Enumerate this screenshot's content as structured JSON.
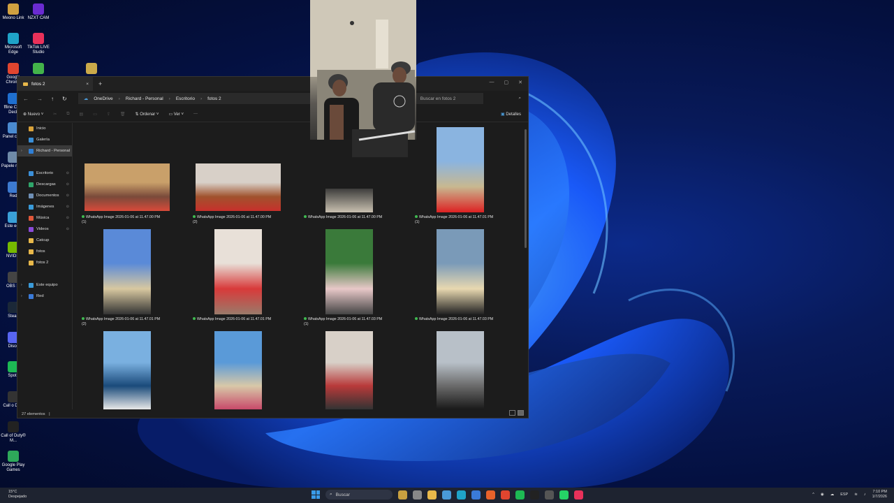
{
  "desktop": {
    "icons": [
      {
        "label": "Meono Link",
        "color": "#d0a040"
      },
      {
        "label": "NZXT CAM",
        "color": "#6a2bd0"
      },
      {
        "label": "Microsoft Edge",
        "color": "#1fa3c8"
      },
      {
        "label": "TikTok LIVE Studio",
        "color": "#e8315a"
      },
      {
        "label": "Google Chrome",
        "color": "#e0452f"
      },
      {
        "label": "",
        "color": "#43b34a"
      },
      {
        "label": "",
        "color": "#caa94a"
      },
      {
        "label": "ffline Co... Deck",
        "color": "#1f6fd0"
      },
      {
        "label": "Panel contr",
        "color": "#4a8ad0"
      },
      {
        "label": "Papele recicl",
        "color": "#6f8aa8"
      },
      {
        "label": "Red",
        "color": "#3d7ad0"
      },
      {
        "label": "Este equi",
        "color": "#3aa0d8"
      },
      {
        "label": "NVIDIA",
        "color": "#76b900"
      },
      {
        "label": "OBS St",
        "color": "#444"
      },
      {
        "label": "Stean",
        "color": "#1b2838"
      },
      {
        "label": "Disco",
        "color": "#5865f2"
      },
      {
        "label": "Spotif",
        "color": "#1db954"
      },
      {
        "label": "Call o Duty",
        "color": "#333"
      },
      {
        "label": "Call of Duty® M...",
        "color": "#222"
      },
      {
        "label": "Google Play Games",
        "color": "#2ea85a"
      }
    ]
  },
  "explorer": {
    "tab_title": "fotos 2",
    "tab_close": "×",
    "new_tab": "+",
    "window_controls": [
      "—",
      "▢",
      "✕"
    ],
    "breadcrumb": [
      "OneDrive",
      "Richard - Personal",
      "Escritorio",
      "fotos 2"
    ],
    "breadcrumb_sep": "›",
    "search_placeholder": "Buscar en fotos 2",
    "toolbar": {
      "new_label": "Nuevo",
      "sort_label": "Ordenar",
      "view_label": "Ver",
      "more": "···",
      "details_label": "Detalles"
    },
    "sidebar": [
      {
        "label": "Inicio",
        "color": "#d9a23a",
        "pinned": false,
        "chevron": false
      },
      {
        "label": "Galería",
        "color": "#3a8ed6",
        "pinned": false,
        "chevron": false
      },
      {
        "label": "Richard - Personal",
        "color": "#2f7fd6",
        "pinned": false,
        "chevron": true,
        "selected": true
      },
      {
        "label": "",
        "color": "transparent",
        "pinned": false,
        "chevron": false
      },
      {
        "label": "Escritorio",
        "color": "#3b8fd8",
        "pinned": true,
        "chevron": false
      },
      {
        "label": "Descargas",
        "color": "#2fa56a",
        "pinned": true,
        "chevron": false
      },
      {
        "label": "Documentos",
        "color": "#6f8fb5",
        "pinned": true,
        "chevron": false
      },
      {
        "label": "Imágenes",
        "color": "#3a9ad8",
        "pinned": true,
        "chevron": false
      },
      {
        "label": "Música",
        "color": "#e0573a",
        "pinned": true,
        "chevron": false
      },
      {
        "label": "Videos",
        "color": "#8a4ad8",
        "pinned": true,
        "chevron": false
      },
      {
        "label": "Catcup",
        "color": "#e8b84a",
        "pinned": false,
        "chevron": false
      },
      {
        "label": "fotos",
        "color": "#e8b84a",
        "pinned": false,
        "chevron": false
      },
      {
        "label": "fotos 2",
        "color": "#e8b84a",
        "pinned": false,
        "chevron": false
      },
      {
        "label": "",
        "color": "transparent",
        "pinned": false,
        "chevron": false
      },
      {
        "label": "Este equipo",
        "color": "#3a9ad8",
        "pinned": false,
        "chevron": true
      },
      {
        "label": "Red",
        "color": "#3a7ad8",
        "pinned": false,
        "chevron": true
      }
    ],
    "files": [
      {
        "name": "WhatsApp Image 2026-01-06 at 11.47.00 PM",
        "suffix": "(1)",
        "colors": [
          "#c9a06a",
          "#7a4a3a",
          "#d84a3a"
        ],
        "landscape": true
      },
      {
        "name": "WhatsApp Image 2026-01-06 at 11.47.00 PM",
        "suffix": "(2)",
        "colors": [
          "#d8d0c8",
          "#a0522d",
          "#c8302c"
        ],
        "landscape": true
      },
      {
        "name": "WhatsApp Image 2026-01-06 at 11.47.00 PM",
        "suffix": "",
        "colors": [
          "#6a6a6a",
          "#333",
          "#c8c0b0"
        ],
        "landscape": false
      },
      {
        "name": "WhatsApp Image 2026-01-06 at 11.47.01 PM",
        "suffix": "(1)",
        "colors": [
          "#8ab4e0",
          "#c8b890",
          "#d22"
        ],
        "landscape": false
      },
      {
        "name": "WhatsApp Image 2026-01-06 at 11.47.01 PM",
        "suffix": "(2)",
        "colors": [
          "#5a8ad8",
          "#d8c8a0",
          "#333"
        ],
        "landscape": false
      },
      {
        "name": "WhatsApp Image 2026-01-06 at 11.47.01 PM",
        "suffix": "",
        "colors": [
          "#e8e0d8",
          "#d83a3a",
          "#9a7a6a"
        ],
        "landscape": false
      },
      {
        "name": "WhatsApp Image 2026-01-06 at 11.47.03 PM",
        "suffix": "(1)",
        "colors": [
          "#3a7a3a",
          "#e8c8c8",
          "#444"
        ],
        "landscape": false
      },
      {
        "name": "WhatsApp Image 2026-01-06 at 11.47.03 PM",
        "suffix": "",
        "colors": [
          "#7a9ab8",
          "#e8d8b0",
          "#222"
        ],
        "landscape": false
      },
      {
        "name": "",
        "suffix": "",
        "colors": [
          "#7ab0e0",
          "#1a4a7a",
          "#e8e8e8"
        ],
        "landscape": false
      },
      {
        "name": "",
        "suffix": "",
        "colors": [
          "#5a9ad8",
          "#d8c8a8",
          "#c84a6a"
        ],
        "landscape": false
      },
      {
        "name": "",
        "suffix": "",
        "colors": [
          "#d8d0c8",
          "#b83a3a",
          "#333"
        ],
        "landscape": false
      },
      {
        "name": "",
        "suffix": "",
        "colors": [
          "#b8c0c8",
          "#6a6a6a",
          "#1a1a1a"
        ],
        "landscape": false
      }
    ],
    "status_count": "27 elementos",
    "status_sep": "|"
  },
  "taskbar": {
    "weather_temp": "15°C",
    "weather_desc": "Despejado",
    "search_placeholder": "Buscar",
    "apps": [
      {
        "name": "search-app",
        "color": "#c8a040"
      },
      {
        "name": "task-view",
        "color": "#888"
      },
      {
        "name": "file-explorer",
        "color": "#e8b84a"
      },
      {
        "name": "copilot",
        "color": "#4a9ad8"
      },
      {
        "name": "edge",
        "color": "#1fa3c8"
      },
      {
        "name": "store",
        "color": "#3a7ad8"
      },
      {
        "name": "firefox",
        "color": "#e8622a"
      },
      {
        "name": "chrome",
        "color": "#e0452f"
      },
      {
        "name": "spotify",
        "color": "#1db954"
      },
      {
        "name": "tiktok",
        "color": "#222"
      },
      {
        "name": "obs",
        "color": "#555"
      },
      {
        "name": "whatsapp",
        "color": "#25d366"
      },
      {
        "name": "tiktok-live",
        "color": "#e8315a"
      }
    ],
    "tray_chevron": "^",
    "language": "ESP",
    "time": "7:10 PM",
    "date": "1/7/2026"
  }
}
